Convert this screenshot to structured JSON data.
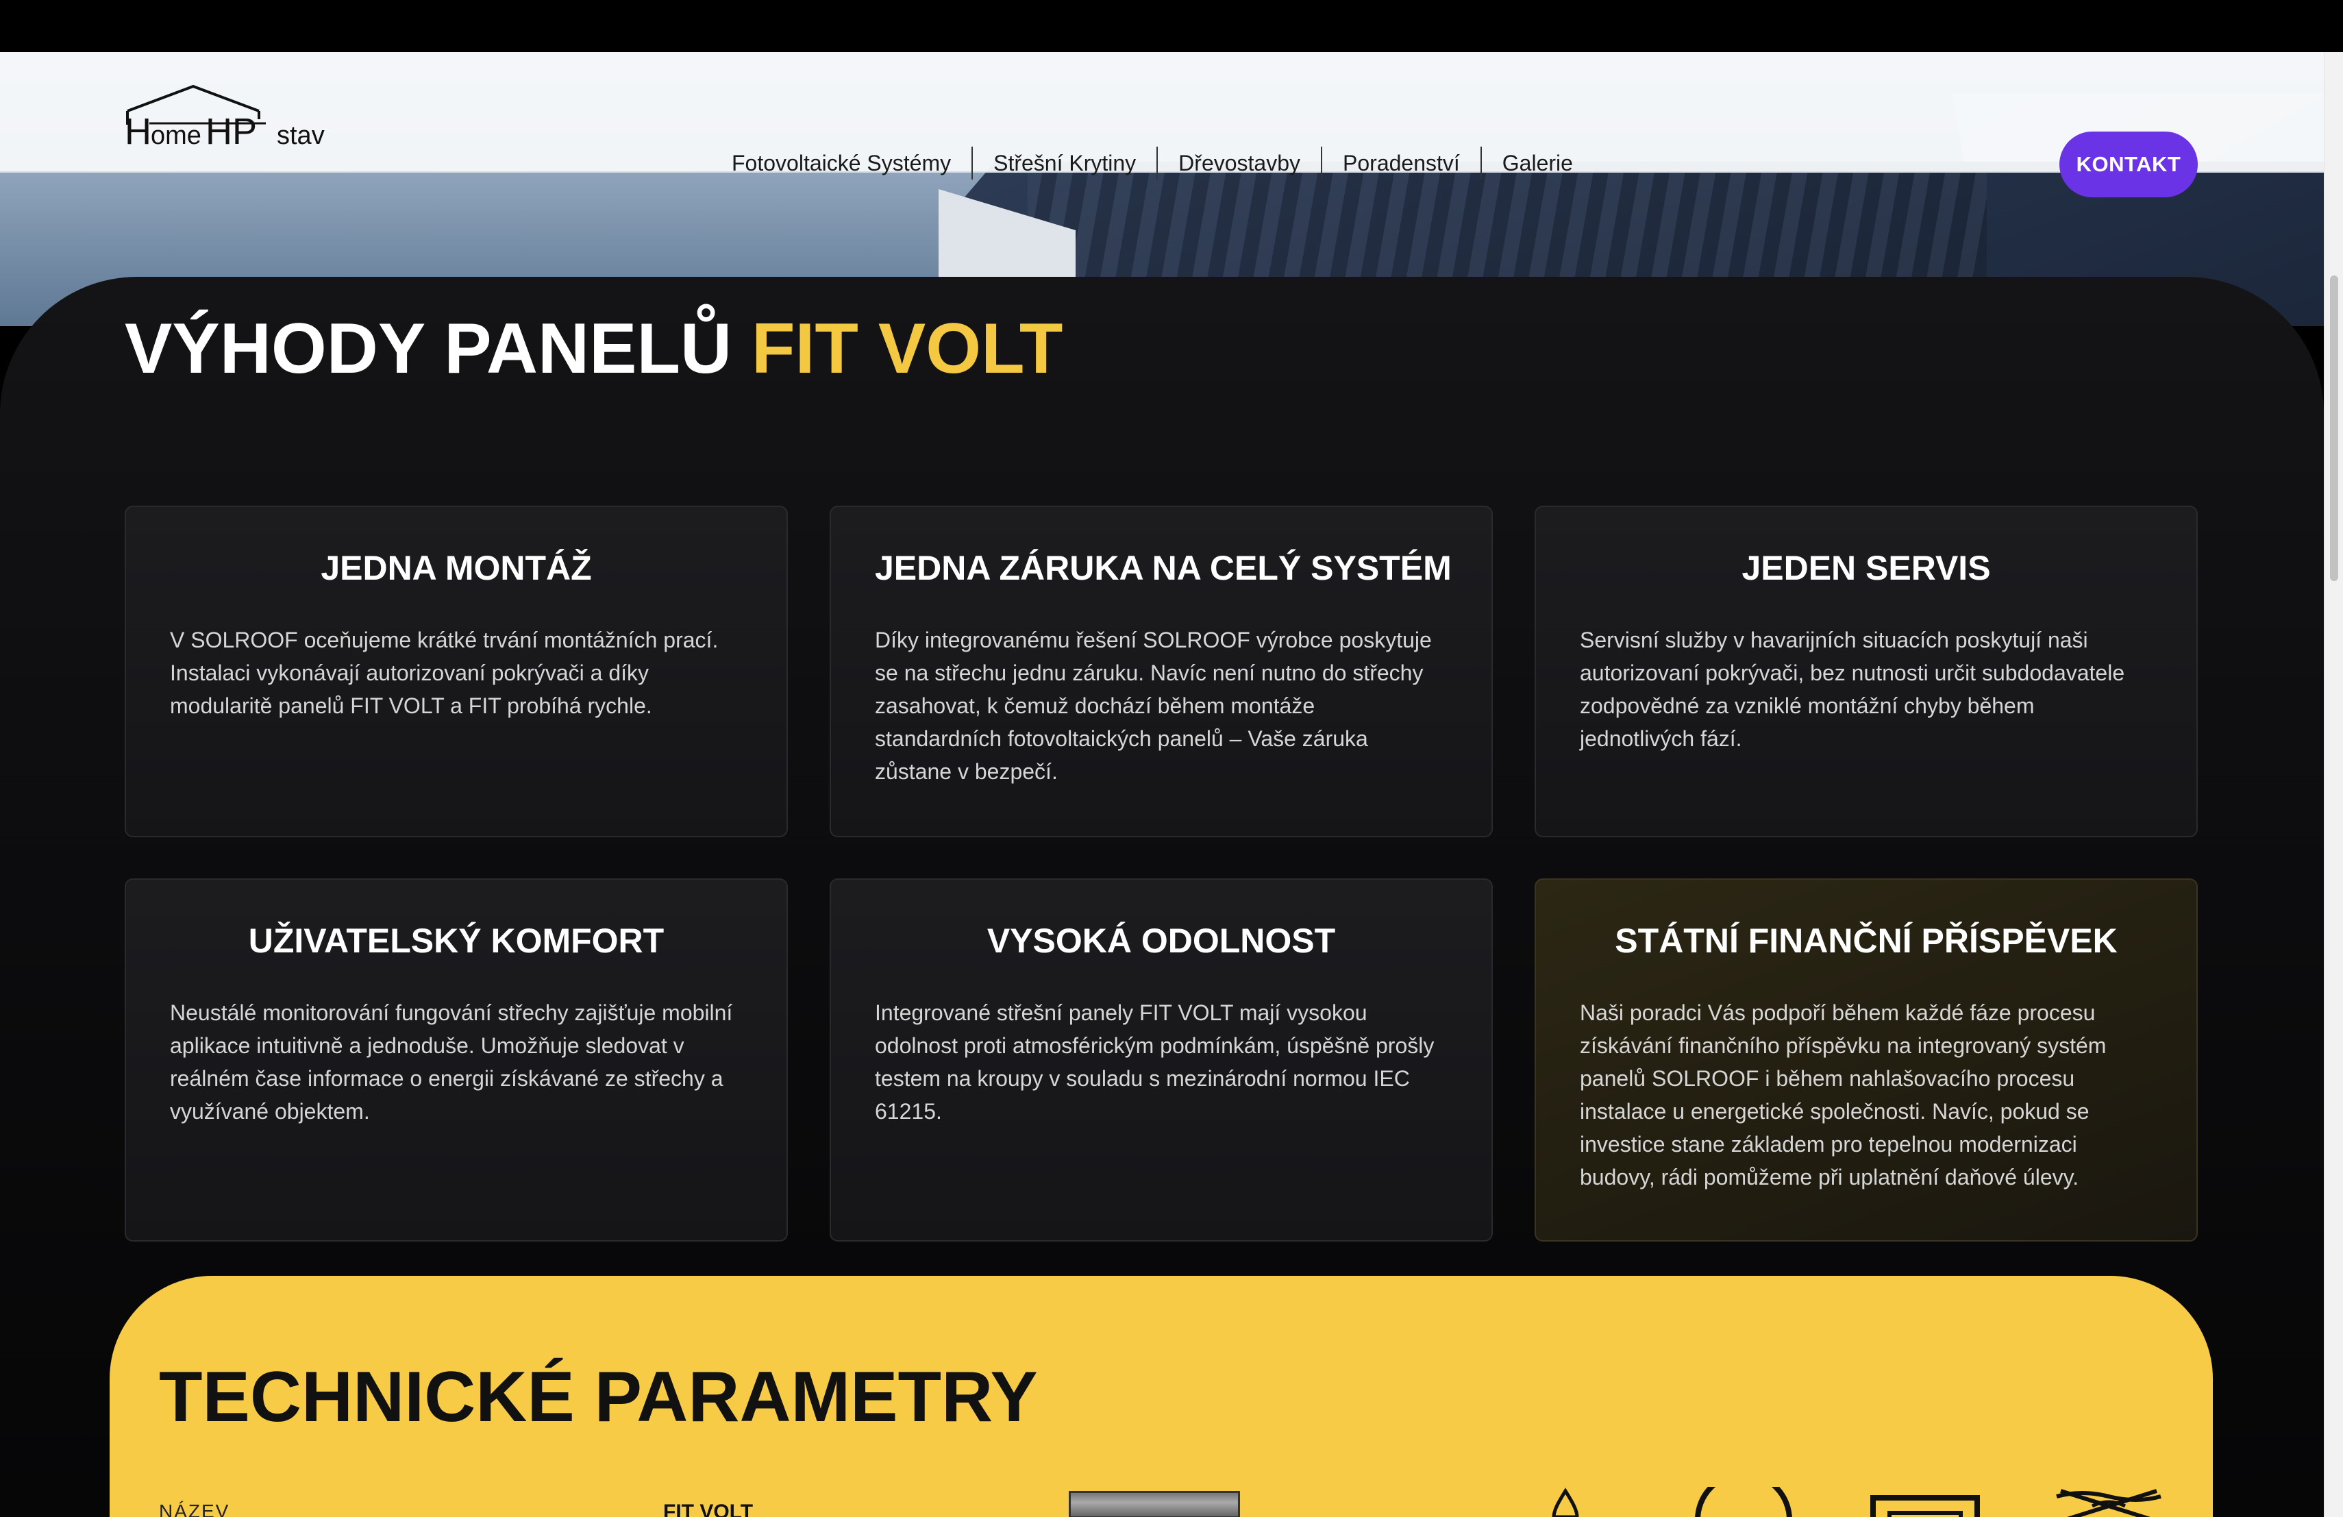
{
  "header": {
    "logo_text": "HomeHPstav",
    "nav_items": [
      "Fotovoltaické Systémy",
      "Střešní Krytiny",
      "Dřevostavby",
      "Poradenství",
      "Galerie"
    ],
    "contact_label": "KONTAKT"
  },
  "colors": {
    "accent_yellow": "#f5c842",
    "brand_purple": "#6b33e6",
    "panel_yellow": "#f7cb45"
  },
  "benefits": {
    "title_main": "VÝHODY PANELŮ",
    "title_accent": "FIT VOLT",
    "cards": [
      {
        "title": "JEDNA MONTÁŽ",
        "text": "V SOLROOF oceňujeme krátké trvání montážních prací. Instalaci vykonávají autorizovaní pokrývači a díky modularitě panelů FIT VOLT a FIT probíhá rychle."
      },
      {
        "title": "JEDNA ZÁRUKA NA CELÝ SYSTÉM",
        "text": "Díky integrovanému řešení SOLROOF výrobce poskytuje se na střechu jednu záruku. Navíc není nutno do střechy zasahovat, k čemuž dochází během montáže standardních fotovoltaických panelů – Vaše záruka zůstane v bezpečí."
      },
      {
        "title": "JEDEN SERVIS",
        "text": "Servisní služby v havarijních situacích poskytují naši autorizovaní pokrývači, bez nutnosti určit subdodavatele zodpovědné za vzniklé montážní chyby během jednotlivých fází."
      },
      {
        "title": "UŽIVATELSKÝ KOMFORT",
        "text": "Neustálé monitorování fungování střechy zajišťuje mobilní aplikace intuitivně a jednoduše. Umožňuje sledovat v reálném čase informace o energii získávané ze střechy a využívané objektem."
      },
      {
        "title": "VYSOKÁ ODOLNOST",
        "text": "Integrované střešní panely FIT VOLT mají vysokou odolnost proti atmosférickým podmínkám, úspěšně prošly testem na kroupy v souladu s mezinárodní normou IEC 61215."
      },
      {
        "title": "STÁTNÍ FINANČNÍ PŘÍSPĚVEK",
        "text": "Naši poradci Vás podpoří během každé fáze procesu získávání finančního příspěvku na integrovaný systém panelů SOLROOF i během nahlašovacího procesu instalace u energetické společnosti. Navíc, pokud se investice stane základem pro tepelnou modernizaci budovy, rádi pomůžeme při uplatnění daňové úlevy."
      }
    ]
  },
  "technical": {
    "title": "TECHNICKÉ PARAMETRY",
    "first_label": "NÁZEV",
    "first_value": "FIT VOLT",
    "icons": [
      "drop-icon",
      "circle-icon",
      "frame-icon",
      "no-wash-icon"
    ]
  }
}
